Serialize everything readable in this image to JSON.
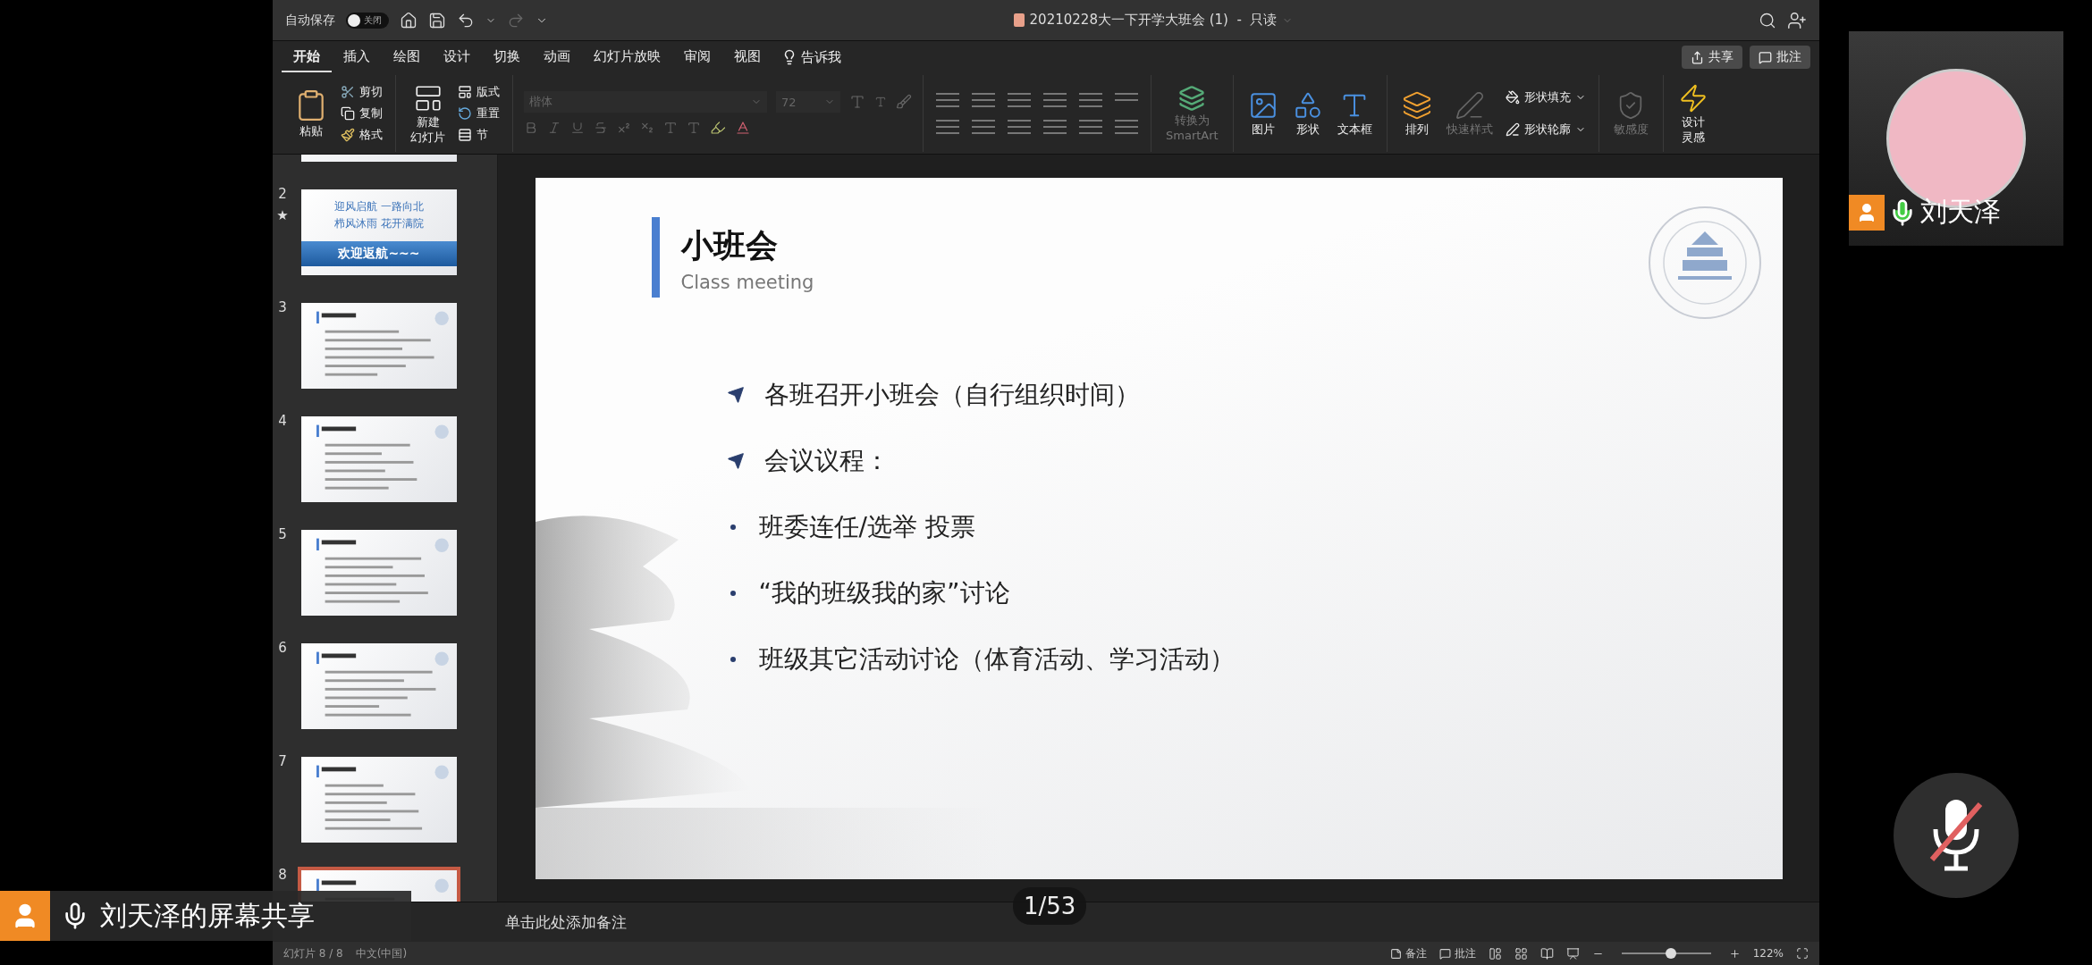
{
  "title_bar": {
    "autosave_label": "自动保存",
    "autosave_toggle": {
      "label": "关闭",
      "on": false
    },
    "document_title": "20210228大一下开学大班会 (1)  -  只读"
  },
  "tabs": [
    {
      "label": "开始",
      "selected": true
    },
    {
      "label": "插入",
      "selected": false
    },
    {
      "label": "绘图",
      "selected": false
    },
    {
      "label": "设计",
      "selected": false
    },
    {
      "label": "切换",
      "selected": false
    },
    {
      "label": "动画",
      "selected": false
    },
    {
      "label": "幻灯片放映",
      "selected": false
    },
    {
      "label": "审阅",
      "selected": false
    },
    {
      "label": "视图",
      "selected": false
    }
  ],
  "tell_me": "告诉我",
  "share_button": "共享",
  "comments_button": "批注",
  "ribbon": {
    "clipboard": {
      "paste": "粘贴",
      "cut": "剪切",
      "copy": "复制",
      "format": "格式"
    },
    "slides": {
      "new_slide": [
        "新建",
        "幻灯片"
      ],
      "layout": "版式",
      "reset": "重置",
      "section": "节"
    },
    "font": {
      "name": "楷体",
      "size": "72",
      "disabled": true
    },
    "smartart": {
      "label": [
        "转换为",
        "SmartArt"
      ],
      "disabled": true
    },
    "insert": [
      "图片",
      "形状",
      "文本框"
    ],
    "drawing": {
      "arrange": "排列",
      "quick_styles": {
        "label": "快速样式",
        "disabled": true
      },
      "shape_fill": "形状填充",
      "shape_outline": "形状轮廓"
    },
    "sensitivity": {
      "label": "敏感度",
      "disabled": true
    },
    "designer": [
      "设计",
      "灵感"
    ]
  },
  "thumbnails": [
    {
      "kind": "cut",
      "selected": false
    },
    {
      "number": "2",
      "kind": "welcome",
      "mark": "★",
      "lines": [
        "迎风启航 一路向北",
        "栉风沐雨 花开满院"
      ],
      "banner": "欢迎返航~~~",
      "selected": false
    },
    {
      "number": "3",
      "kind": "content",
      "selected": false
    },
    {
      "number": "4",
      "kind": "content",
      "selected": false
    },
    {
      "number": "5",
      "kind": "content",
      "selected": false
    },
    {
      "number": "6",
      "kind": "content",
      "selected": false
    },
    {
      "number": "7",
      "kind": "content",
      "selected": false
    },
    {
      "number": "8",
      "kind": "content",
      "selected": true
    }
  ],
  "slide": {
    "title": "小班会",
    "subtitle": "Class meeting",
    "bullets": [
      {
        "kind": "arrow",
        "text": "各班召开小班会（自行组织时间）"
      },
      {
        "kind": "arrow",
        "text": "会议议程："
      },
      {
        "kind": "dot",
        "text": "班委连任/选举 投票"
      },
      {
        "kind": "dot",
        "text": "“我的班级我的家”讨论"
      },
      {
        "kind": "dot",
        "text": "班级其它活动讨论（体育活动、学习活动）"
      }
    ]
  },
  "notes_placeholder": "单击此处添加备注",
  "status_bar": {
    "slide_info": "幻灯片 8 / 8",
    "language": "中文(中国)",
    "notes": "备注",
    "comments": "批注",
    "zoom": {
      "level": 0.55
    },
    "zoom_text": "122%"
  },
  "page_counter": "1/53",
  "participant": {
    "name": "刘天泽",
    "speaking": true
  },
  "screen_share_label": "刘天泽的屏幕共享",
  "mute_button": {
    "muted": true
  }
}
